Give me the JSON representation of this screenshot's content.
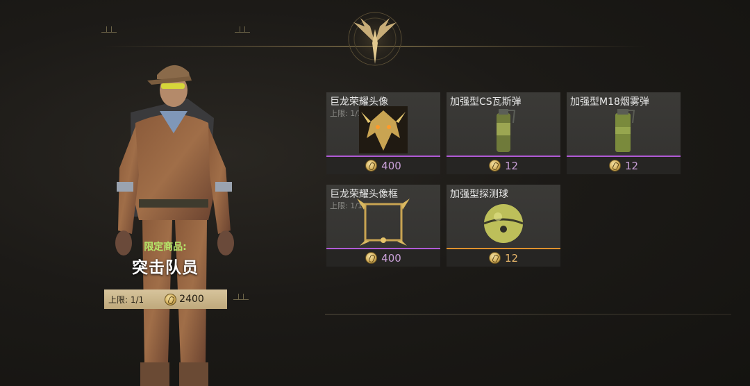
{
  "character": {
    "limited_label": "限定商品:",
    "name": "突击队员",
    "limit_text": "上限: 1/1",
    "price": "2400",
    "currency_icon": "coin-icon"
  },
  "items": [
    {
      "title": "巨龙荣耀头像",
      "limit": "上限: 1/1",
      "price": "400",
      "rarity_color": "#b05ad6",
      "icon": "dragon-avatar-icon"
    },
    {
      "title": "加强型CS瓦斯弹",
      "price": "12",
      "rarity_color": "#b05ad6",
      "icon": "gas-grenade-icon"
    },
    {
      "title": "加强型M18烟雾弹",
      "price": "12",
      "rarity_color": "#b05ad6",
      "icon": "smoke-grenade-icon"
    },
    {
      "title": "巨龙荣耀头像框",
      "limit": "上限: 1/1",
      "price": "400",
      "rarity_color": "#b05ad6",
      "icon": "dragon-frame-icon"
    },
    {
      "title": "加强型探测球",
      "price": "12",
      "rarity_color": "#e0922e",
      "icon": "detector-ball-icon"
    }
  ],
  "colors": {
    "accent_green": "#b6e86a",
    "rarity_purple": "#b05ad6",
    "rarity_orange": "#e0922e",
    "gold": "#d6b25e"
  }
}
